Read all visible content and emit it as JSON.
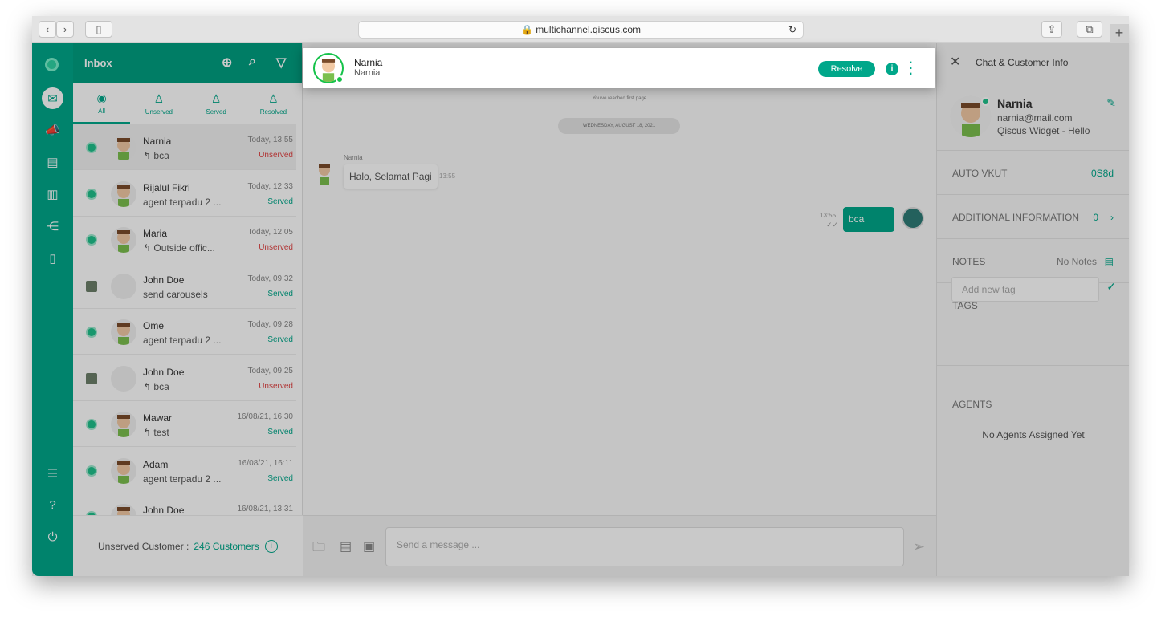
{
  "browser": {
    "url": "multichannel.qiscus.com"
  },
  "inbox": {
    "title": "Inbox",
    "tabs": [
      {
        "label": "All"
      },
      {
        "label": "Unserved"
      },
      {
        "label": "Served"
      },
      {
        "label": "Resolved"
      }
    ],
    "rows": [
      {
        "name": "Narnia",
        "preview": "bca",
        "time": "Today, 13:55",
        "status": "Unserved",
        "status_class": "uns",
        "reply": true
      },
      {
        "name": "Rijalul Fikri",
        "preview": "agent terpadu 2 ...",
        "time": "Today, 12:33",
        "status": "Served",
        "status_class": "srv",
        "reply": false
      },
      {
        "name": "Maria",
        "preview": "Outside offic...",
        "time": "Today, 12:05",
        "status": "Unserved",
        "status_class": "uns",
        "reply": true
      },
      {
        "name": "John Doe",
        "preview": "send carousels",
        "time": "Today, 09:32",
        "status": "Served",
        "status_class": "srv",
        "reply": false
      },
      {
        "name": "Ome",
        "preview": "agent terpadu 2 ...",
        "time": "Today, 09:28",
        "status": "Served",
        "status_class": "srv",
        "reply": false
      },
      {
        "name": "John Doe",
        "preview": "bca",
        "time": "Today, 09:25",
        "status": "Unserved",
        "status_class": "uns",
        "reply": true
      },
      {
        "name": "Mawar",
        "preview": "test",
        "time": "16/08/21, 16:30",
        "status": "Served",
        "status_class": "srv",
        "reply": true
      },
      {
        "name": "Adam",
        "preview": "agent terpadu 2 ...",
        "time": "16/08/21, 16:11",
        "status": "Served",
        "status_class": "srv",
        "reply": false
      },
      {
        "name": "John Doe",
        "preview": "",
        "time": "16/08/21, 13:31",
        "status": "",
        "status_class": "srv",
        "reply": false
      }
    ],
    "footer": {
      "label": "Unserved Customer :",
      "count": "246 Customers"
    }
  },
  "chat": {
    "name": "Narnia",
    "subtitle": "Narnia",
    "resolve": "Resolve",
    "first_page": "You've reached first page",
    "date": "WEDNESDAY, AUGUST 18, 2021",
    "in_sender": "Narnia",
    "in_text": "Halo, Selamat Pagi",
    "in_time": "13:55",
    "out_text": "bca",
    "out_time": "13:55",
    "placeholder": "Send a message ..."
  },
  "info": {
    "title": "Chat & Customer Info",
    "name": "Narnia",
    "email": "narnia@mail.com",
    "source": "Qiscus Widget - Hello",
    "auto_label": "AUTO VKUT",
    "auto_value": "0S8d",
    "addl_label": "ADDITIONAL INFORMATION",
    "addl_value": "0",
    "notes_label": "NOTES",
    "notes_value": "No Notes",
    "tags_label": "TAGS",
    "tag_placeholder": "Add new tag",
    "agents_label": "AGENTS",
    "agents_value": "No Agents Assigned Yet"
  },
  "colors": {
    "brand": "#00a78a",
    "unserved": "#e04444",
    "online": "#15c24a"
  }
}
